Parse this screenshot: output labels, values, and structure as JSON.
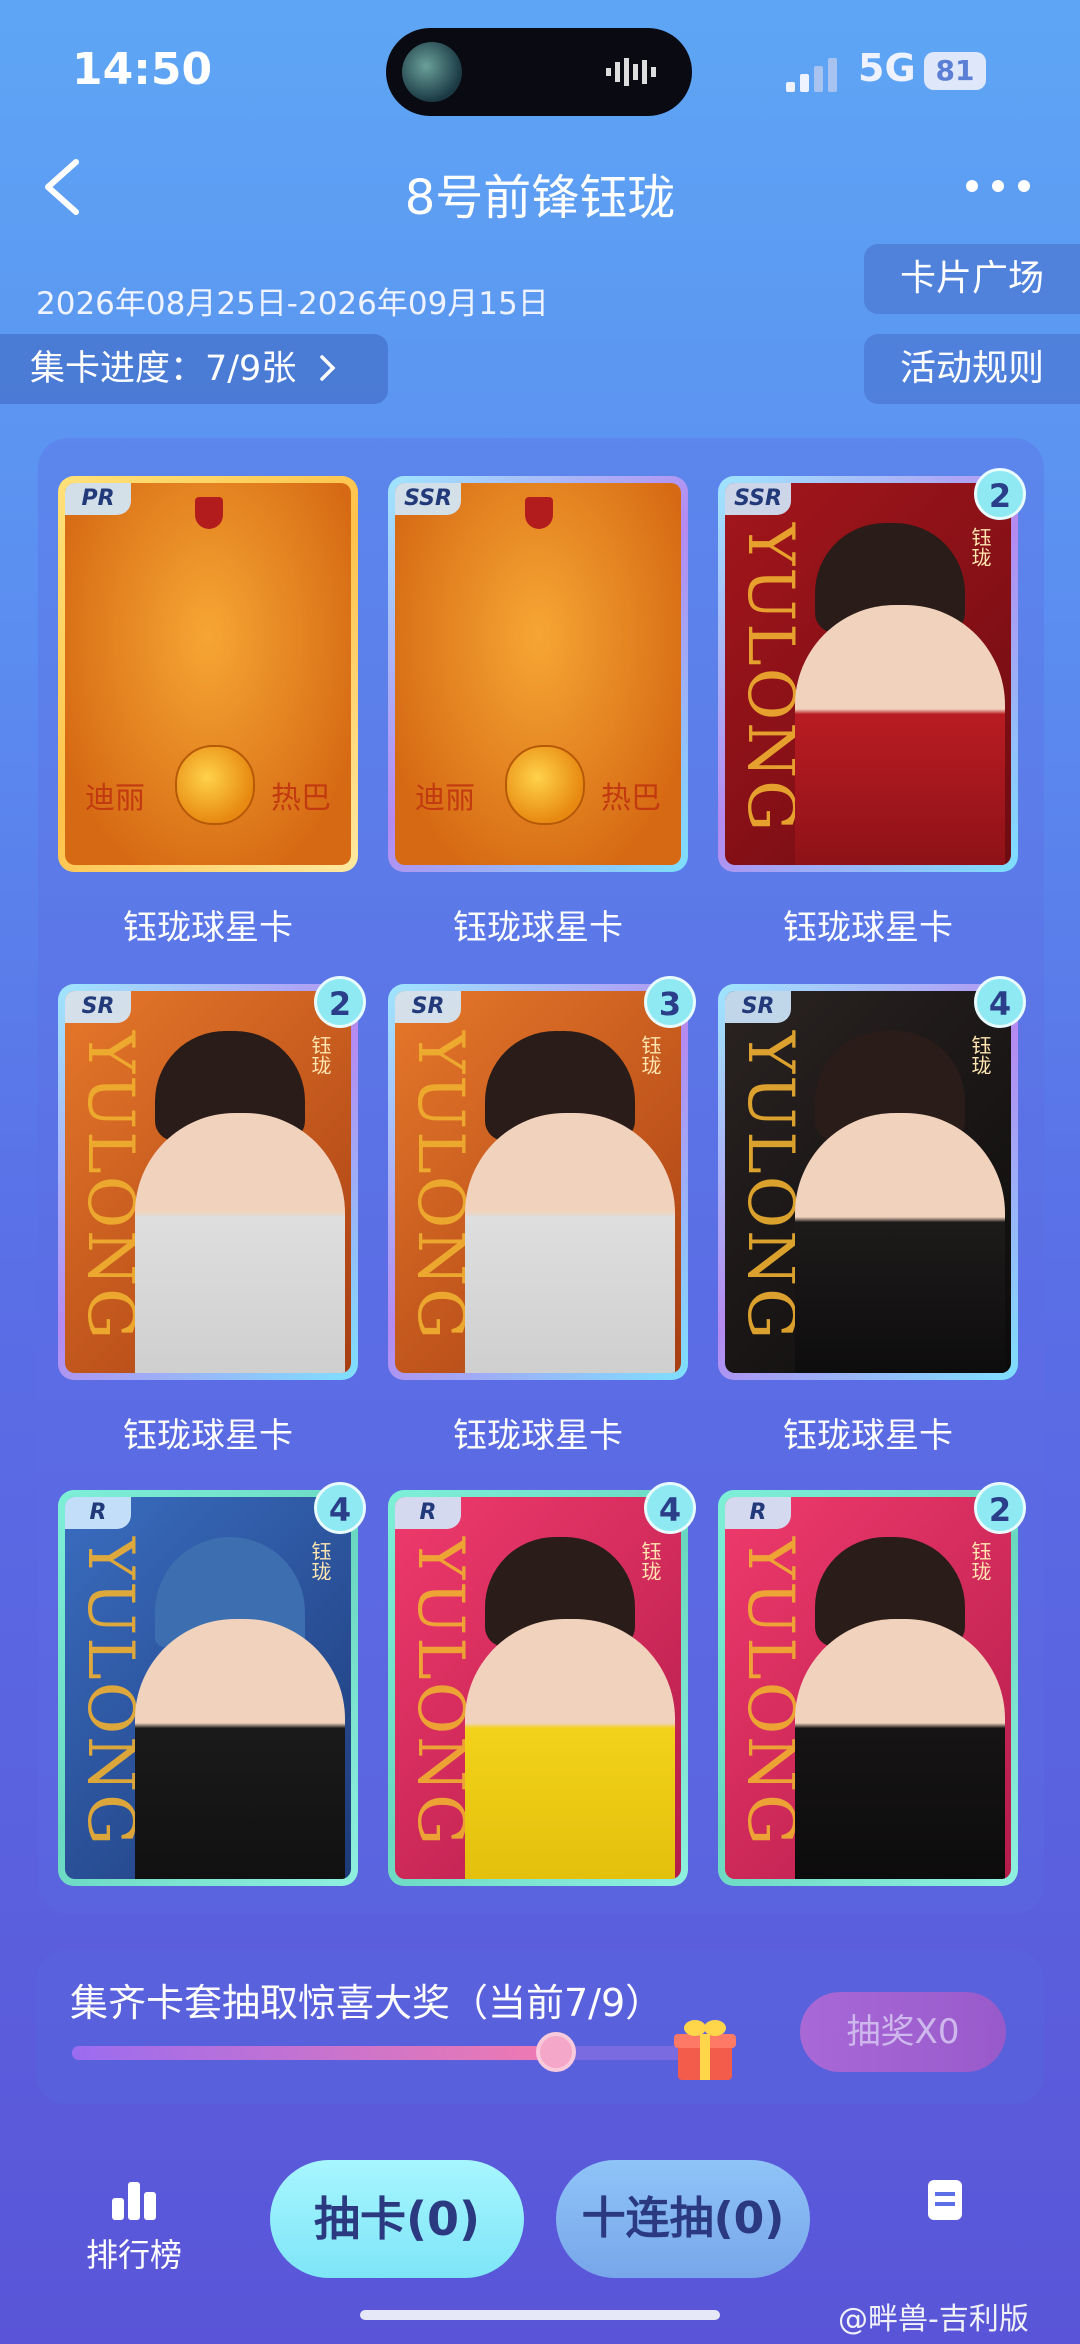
{
  "status_bar": {
    "time": "14:50",
    "network": "5G",
    "battery": "81"
  },
  "header": {
    "title": "8号前锋钰珑"
  },
  "event": {
    "dates": "2026年08月25日-2026年09月15日",
    "progress_label": "集卡进度：7/9张"
  },
  "side_buttons": {
    "card_plaza": "卡片广场",
    "rules": "活动规则"
  },
  "cards": [
    {
      "rarity": "PR",
      "label": "钰珑球星卡",
      "count": ""
    },
    {
      "rarity": "SSR",
      "label": "钰珑球星卡",
      "count": ""
    },
    {
      "rarity": "SSR",
      "label": "钰珑球星卡",
      "count": "2"
    },
    {
      "rarity": "SR",
      "label": "钰珑球星卡",
      "count": "2"
    },
    {
      "rarity": "SR",
      "label": "钰珑球星卡",
      "count": "3"
    },
    {
      "rarity": "SR",
      "label": "钰珑球星卡",
      "count": "4"
    },
    {
      "rarity": "R",
      "label": "",
      "count": "4"
    },
    {
      "rarity": "R",
      "label": "",
      "count": "4"
    },
    {
      "rarity": "R",
      "label": "",
      "count": "2"
    }
  ],
  "card_art": {
    "left_name": "迪丽",
    "right_name": "热巴",
    "brand": "YULONG",
    "side_name": "钰珑"
  },
  "prize": {
    "text": "集齐卡套抽取惊喜大奖（当前7/9）",
    "progress": 0.78,
    "draw_label": "抽奖X0"
  },
  "bottom": {
    "rank_label": "排行榜",
    "draw_one": "抽卡(0)",
    "draw_ten": "十连抽(0)"
  },
  "watermark": "@畔兽-吉利版",
  "icons": [
    "back-icon",
    "more-icon",
    "chevron-right-icon",
    "gift-icon",
    "rank-icon",
    "doc-icon"
  ]
}
